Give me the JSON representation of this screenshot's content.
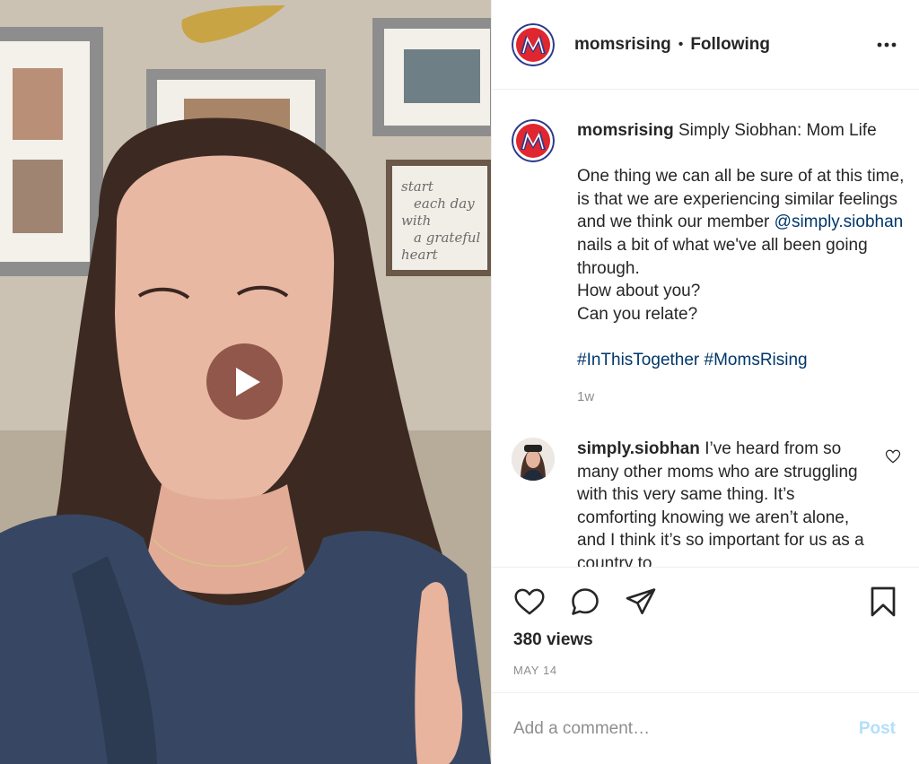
{
  "post": {
    "account": "momsrising",
    "follow_separator": "•",
    "follow_state": "Following",
    "caption": {
      "username": "momsrising",
      "title": "Simply Siobhan: Mom Life",
      "text_before_mention": "One thing we can all be sure of at this time, is that we are experiencing similar feelings and we think our member",
      "mention": "@simply.siobhan",
      "text_after_mention": "nails a bit of what we've all been going through.",
      "line_question_1": "How about you?",
      "line_question_2": "Can you relate?",
      "hashtags": "#InThisTogether #MomsRising",
      "age": "1w"
    },
    "comments": [
      {
        "username": "simply.siobhan",
        "text": "I’ve heard from so many other moms who are struggling with this very same thing. It’s comforting knowing we aren’t alone, and I think it’s so important for us as a country to"
      }
    ],
    "views": "380 views",
    "date": "MAY 14",
    "add_comment_placeholder": "Add a comment…",
    "post_button": "Post"
  },
  "media": {
    "type": "video",
    "wall_sign_text": [
      "start",
      "each day",
      "with",
      "a grateful",
      "heart"
    ]
  },
  "icons": {
    "play": "play-icon",
    "more": "more-options-icon",
    "like": "heart-icon",
    "comment": "comment-icon",
    "share": "share-icon",
    "save": "bookmark-icon"
  },
  "colors": {
    "brand_red": "#e0262e",
    "brand_blue": "#2d3a8c",
    "link": "#00376b",
    "muted": "#8e8e8e",
    "post_disabled": "#b2dffc"
  }
}
